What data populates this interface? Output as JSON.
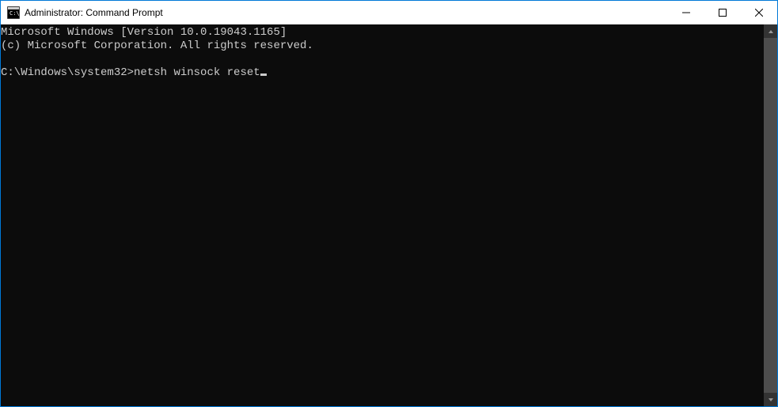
{
  "titlebar": {
    "title": "Administrator: Command Prompt"
  },
  "terminal": {
    "line1": "Microsoft Windows [Version 10.0.19043.1165]",
    "line2": "(c) Microsoft Corporation. All rights reserved.",
    "blank": "",
    "prompt": "C:\\Windows\\system32>",
    "command": "netsh winsock reset"
  }
}
